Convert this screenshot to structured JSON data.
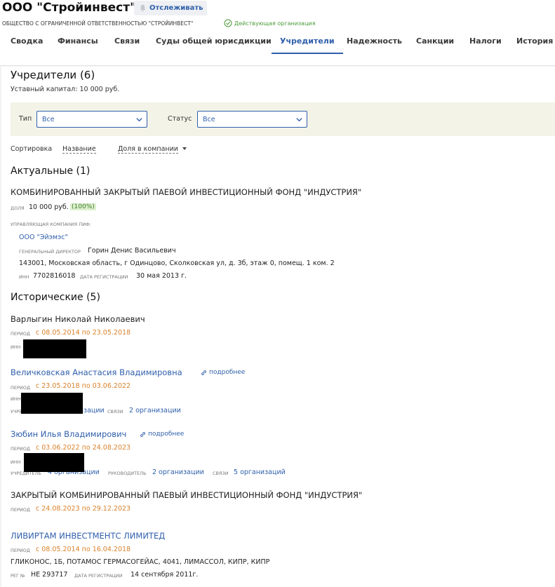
{
  "header": {
    "company_name": "ООО \"Стройинвест\"",
    "track_label": "Отслеживать",
    "legal_name": "ОБЩЕСТВО С ОГРАНИЧЕННОЙ ОТВЕТСТВЕННОСТЬЮ \"СТРОЙИНВЕСТ\"",
    "status": "Действующая организация"
  },
  "tabs": [
    "Сводка",
    "Финансы",
    "Связи",
    "Суды общей юрисдикции",
    "Учредители",
    "Надежность",
    "Санкции",
    "Налоги",
    "История"
  ],
  "active_tab": "Учредители",
  "page": {
    "title": "Учредители (6)",
    "capital": "Уставный капитал: 10 000 руб."
  },
  "filters": {
    "type_label": "Тип",
    "type_value": "Все",
    "status_label": "Статус",
    "status_value": "Все"
  },
  "sort": {
    "label": "Сортировка",
    "by_name": "Название",
    "by_share": "Доля в компании"
  },
  "captions": {
    "share": "доля",
    "period": "период",
    "inn": "инн",
    "founder": "учредитель",
    "links": "связи",
    "director": "руководитель",
    "reg_no": "рег №",
    "reg_date": "дата регистрации",
    "manager": "управляющая компания пиф:",
    "gen_director": "генеральный директор",
    "more": "подробнее"
  },
  "current": {
    "heading": "Актуальные (1)",
    "name": "КОМБИНИРОВАННЫЙ ЗАКРЫТЫЙ ПАЕВОЙ ИНВЕСТИЦИОННЫЙ ФОНД \"ИНДУСТРИЯ\"",
    "share": "10 000 руб.",
    "share_pct": "(100%)",
    "manager_name": "ООО \"Эйэмэс\"",
    "director": "Горин Денис Васильевич",
    "address": "143001, Московская область, г Одинцово, Сколковская ул, д. 3б, этаж 0, помещ. 1 ком. 2",
    "inn": "7702816018",
    "reg_date": "30 мая 2013 г."
  },
  "historical": {
    "heading": "Исторические (5)",
    "items": [
      {
        "name": "Варлыгин Николай Николаевич",
        "period": "с 08.05.2014 по 23.05.2018"
      },
      {
        "name": "Величковская Анастасия Владимировна",
        "period": "с 23.05.2018 по 03.06.2022",
        "founder": "организации",
        "links": "2 организации"
      },
      {
        "name": "Зюбин Илья Владимирович",
        "period": "с 03.06.2022 по 24.08.2023",
        "founder": "4 организации",
        "director": "2 организации",
        "links": "5 организаций"
      },
      {
        "name": "ЗАКРЫТЫЙ КОМБИНИРОВАННЫЙ ПАЕВЫЙ ИНВЕСТИЦИОННЫЙ ФОНД \"ИНДУСТРИЯ\"",
        "period": "с 24.08.2023 по 29.12.2023"
      },
      {
        "name": "ЛИВИРТАМ ИНВЕСТМЕНТС ЛИМИТЕД",
        "period": "с 08.05.2014 по 16.04.2018",
        "address": "ГЛИКОНОС, 1Б, ПОТАМОС ГЕРМАСОГЕЙАС, 4041, ЛИМАССОЛ, КИПР, КИПР",
        "reg_no": "НЕ 293717",
        "reg_date": "14 сентября 2011г."
      }
    ]
  },
  "colors": {
    "link": "#2f5fab",
    "period": "#d9822b",
    "status_green": "#4b9b3a",
    "filter_bg": "#f3f3e8"
  },
  "icons": {
    "track": "bell-icon",
    "status": "check-circle-icon",
    "select": "chevron-down-icon",
    "sort": "caret-down-icon",
    "more": "link-icon"
  }
}
